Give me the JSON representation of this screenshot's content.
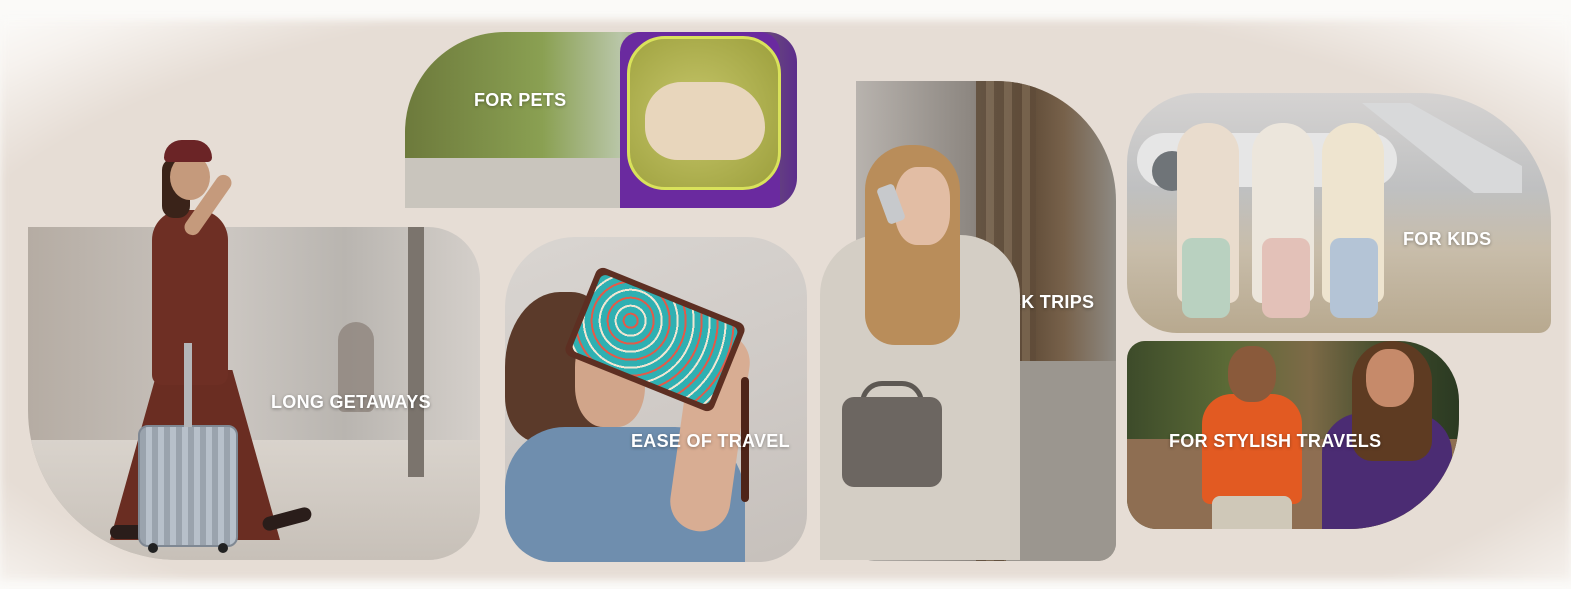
{
  "tiles": {
    "long_getaways": {
      "label": "LONG GETAWAYS"
    },
    "for_pets": {
      "label": "FOR PETS"
    },
    "ease_of_travel": {
      "label": "EASE OF TRAVEL"
    },
    "quick_trips": {
      "label": "QUICK TRIPS"
    },
    "for_kids": {
      "label": "FOR KIDS"
    },
    "for_stylish_travels": {
      "label": "FOR STYLISH TRAVELS"
    }
  },
  "colors": {
    "backdrop": "#e6ddd5",
    "label_text": "#ffffff",
    "page_background": "#fbfaf8"
  }
}
